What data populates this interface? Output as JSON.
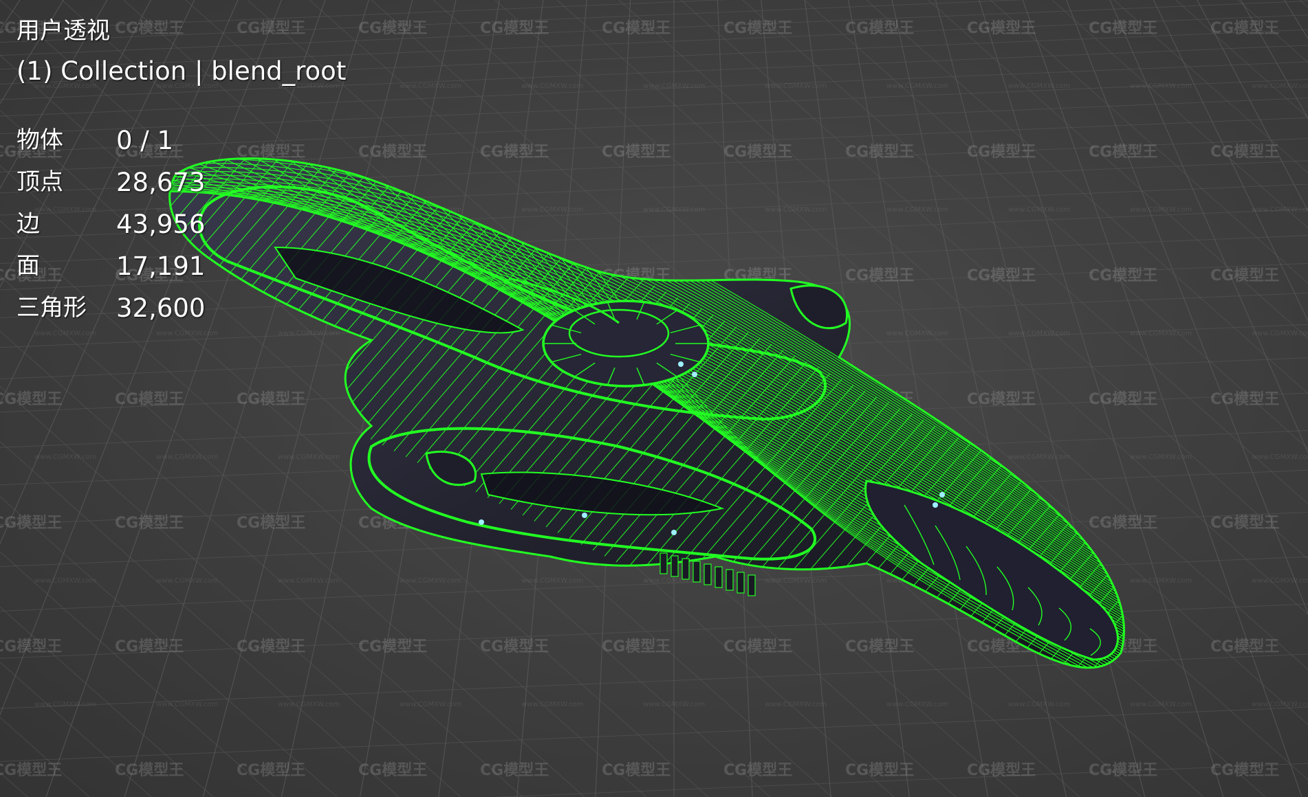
{
  "viewport": {
    "view_name": "用户透视",
    "collection_line": "(1) Collection | blend_root",
    "stats": [
      {
        "label": "物体",
        "value": "0 / 1"
      },
      {
        "label": "顶点",
        "value": "28,673"
      },
      {
        "label": "边",
        "value": "43,956"
      },
      {
        "label": "面",
        "value": "17,191"
      },
      {
        "label": "三角形",
        "value": "32,600"
      }
    ],
    "colors": {
      "background": "#3c3c3c",
      "grid": "#5a5a5a",
      "wireframe": "#22ff22",
      "hull_shade": "#2a2a3a",
      "accent_light": "#9ff0ff",
      "overlay_text": "#ffffff"
    }
  },
  "watermark": {
    "text": "CG模型王",
    "sub_text": "www.CGMXW.com"
  }
}
